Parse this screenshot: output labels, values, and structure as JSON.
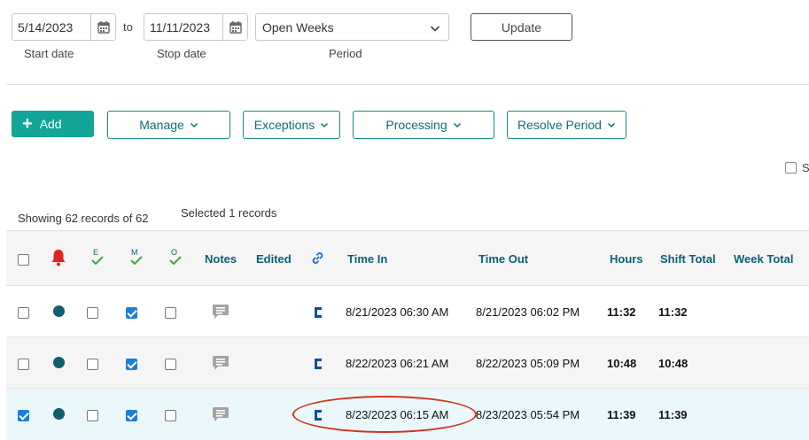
{
  "filters": {
    "start_date": "5/14/2023",
    "to_label": "to",
    "stop_date": "11/11/2023",
    "period": "Open Weeks",
    "update_label": "Update",
    "start_date_label": "Start date",
    "stop_date_label": "Stop date",
    "period_label": "Period"
  },
  "actions": {
    "add": "Add",
    "manage": "Manage",
    "exceptions": "Exceptions",
    "processing": "Processing",
    "resolve_period": "Resolve Period",
    "show_truncated": "S"
  },
  "summary": {
    "showing": "Showing 62 records of 62",
    "selected": "Selected 1 records"
  },
  "table": {
    "headers": {
      "e": "E",
      "m": "M",
      "o": "O",
      "notes": "Notes",
      "edited": "Edited",
      "time_in": "Time In",
      "time_out": "Time Out",
      "hours": "Hours",
      "shift_total": "Shift Total",
      "week_total": "Week Total"
    },
    "rows": [
      {
        "selected": false,
        "e": false,
        "m": true,
        "o": false,
        "time_in": "8/21/2023 06:30 AM",
        "time_out": "8/21/2023 06:02 PM",
        "hours": "11:32",
        "shift_total": "11:32"
      },
      {
        "selected": false,
        "e": false,
        "m": true,
        "o": false,
        "time_in": "8/22/2023 06:21 AM",
        "time_out": "8/22/2023 05:09 PM",
        "hours": "10:48",
        "shift_total": "10:48"
      },
      {
        "selected": true,
        "e": false,
        "m": true,
        "o": false,
        "time_in": "8/23/2023 06:15 AM",
        "time_out": "8/23/2023 05:54 PM",
        "hours": "11:39",
        "shift_total": "11:39"
      }
    ]
  },
  "colors": {
    "accent": "#13a597",
    "header_text": "#0c5f73",
    "row_alt": "#f5f5f5",
    "row_selected": "#eaf8fb",
    "highlight_ellipse": "#d3361f",
    "alert_bell": "#e02424",
    "check_green": "#3cab45"
  }
}
